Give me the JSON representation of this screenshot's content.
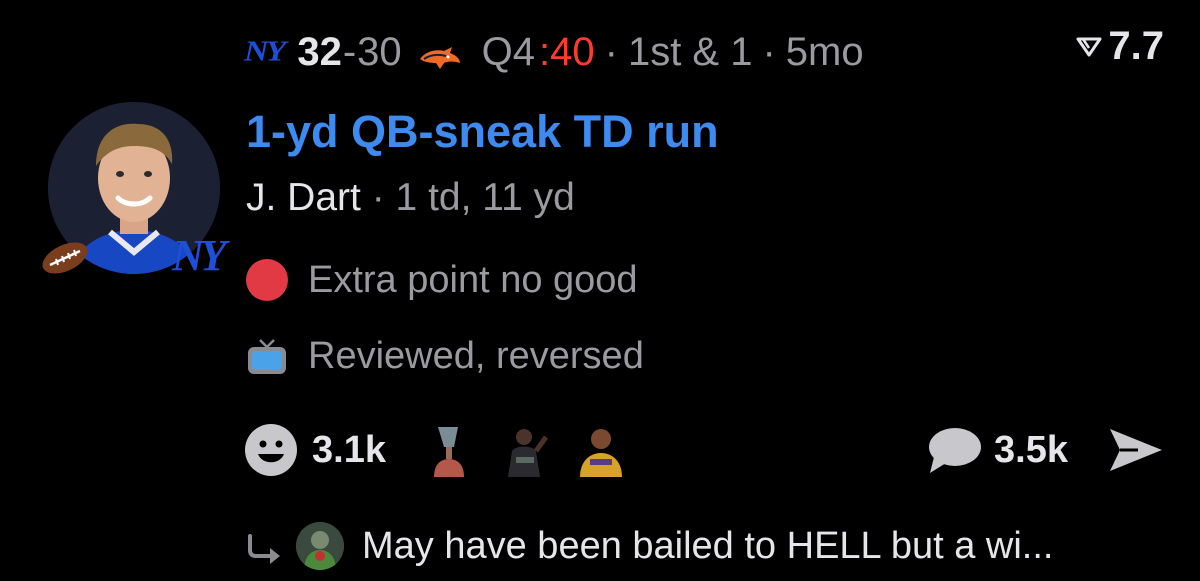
{
  "header": {
    "home_team_logo": "NY",
    "home_score": "32",
    "score_separator": "-",
    "away_score": "30",
    "opponent_logo_icon": "broncos-logo-icon",
    "quarter": "Q4",
    "clock": ":40",
    "down_distance": "1st & 1",
    "age": "5mo",
    "separator": "·",
    "rating": "7.7"
  },
  "play": {
    "title": "1-yd QB-sneak TD run",
    "player_name": "J. Dart",
    "player_stats": "1 td, 11 yd",
    "separator": "·"
  },
  "events": [
    {
      "icon": "red-dot-icon",
      "text": "Extra point no good"
    },
    {
      "icon": "tv-icon",
      "text": "Reviewed, reversed"
    }
  ],
  "reactions": {
    "count": "3.1k",
    "comments_count": "3.5k"
  },
  "reply": {
    "text": "May have been bailed to HELL but a wi..."
  },
  "colors": {
    "background": "#000000",
    "link_blue": "#3d8bf0",
    "clock_red": "#ff3b30",
    "dot_red": "#e23a44",
    "team_blue": "#1e4fd8"
  }
}
